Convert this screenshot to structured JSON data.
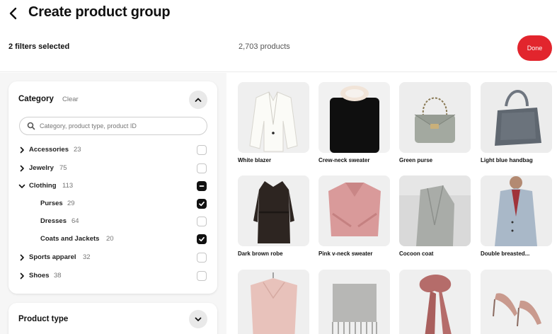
{
  "page": {
    "title": "Create product group"
  },
  "topbar": {
    "filters_selected": "2 filters selected",
    "products_count": "2,703 products",
    "done_label": "Done"
  },
  "colors": {
    "accent": "#e2252d",
    "checkbox_checked": "#111111"
  },
  "category_panel": {
    "title": "Category",
    "clear_label": "Clear",
    "search_placeholder": "Category, product type, product ID",
    "items": [
      {
        "label": "Accessories",
        "count": "23",
        "state": "unchecked",
        "expanded": false
      },
      {
        "label": "Jewelry",
        "count": "75",
        "state": "unchecked",
        "expanded": false
      },
      {
        "label": "Clothing",
        "count": "113",
        "state": "indeterminate",
        "expanded": true
      },
      {
        "label": "Purses",
        "count": "29",
        "state": "checked"
      },
      {
        "label": "Dresses",
        "count": "64",
        "state": "unchecked"
      },
      {
        "label": "Coats and Jackets",
        "count": "20",
        "state": "checked"
      },
      {
        "label": "Sports apparel",
        "count": "32",
        "state": "unchecked",
        "expanded": false
      },
      {
        "label": "Shoes",
        "count": "38",
        "state": "unchecked",
        "expanded": false
      }
    ]
  },
  "product_type_panel": {
    "title": "Product type"
  },
  "products": [
    {
      "name": "White blazer"
    },
    {
      "name": "Crew-neck sweater"
    },
    {
      "name": "Green purse"
    },
    {
      "name": "Light blue handbag"
    },
    {
      "name": "Dark brown robe"
    },
    {
      "name": "Pink v-neck sweater"
    },
    {
      "name": "Cocoon coat"
    },
    {
      "name": "Double breasted..."
    },
    {
      "name": ""
    },
    {
      "name": ""
    },
    {
      "name": ""
    },
    {
      "name": ""
    }
  ]
}
